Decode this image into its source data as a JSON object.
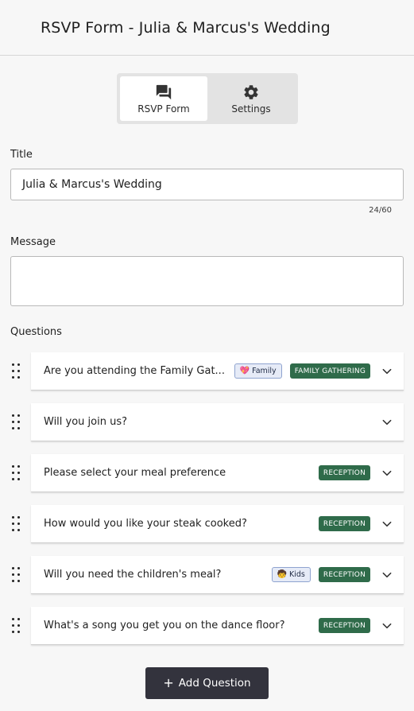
{
  "header": {
    "title": "RSVP Form - Julia & Marcus's Wedding"
  },
  "tabs": [
    {
      "label": "RSVP Form",
      "icon": "chat-bubbles-icon",
      "active": true
    },
    {
      "label": "Settings",
      "icon": "gear-icon",
      "active": false
    }
  ],
  "form": {
    "title_label": "Title",
    "title_value": "Julia & Marcus's Wedding",
    "title_counter": "24/60",
    "message_label": "Message",
    "message_value": "",
    "questions_label": "Questions"
  },
  "questions": [
    {
      "text": "Are you attending the Family Gat...",
      "category": {
        "label": "Family",
        "icon": "💖"
      },
      "event": "FAMILY GATHERING"
    },
    {
      "text": "Will you join us?",
      "category": null,
      "event": null
    },
    {
      "text": "Please select your meal preference",
      "category": null,
      "event": "RECEPTION"
    },
    {
      "text": "How would you like your steak cooked?",
      "category": null,
      "event": "RECEPTION"
    },
    {
      "text": "Will you need the children's meal?",
      "category": {
        "label": "Kids",
        "icon": "🧒"
      },
      "event": "RECEPTION"
    },
    {
      "text": "What's a song you get you on the dance floor?",
      "category": null,
      "event": "RECEPTION"
    }
  ],
  "actions": {
    "add_question": "Add Question"
  },
  "colors": {
    "event_badge": "#2f6b4a",
    "category_badge_bg": "#e6ebf7",
    "add_button": "#33333d"
  }
}
